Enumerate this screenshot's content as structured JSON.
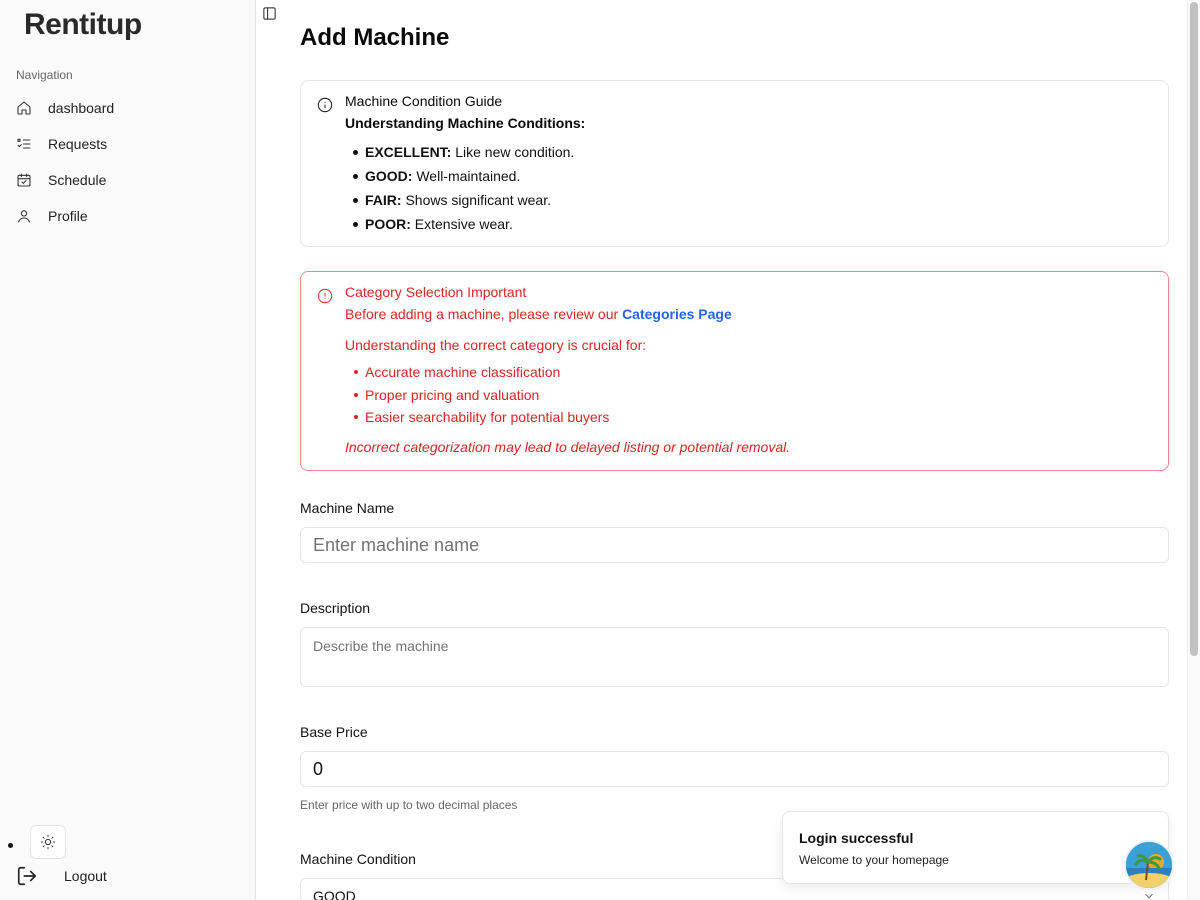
{
  "app": {
    "brand": "Rentitup"
  },
  "sidebar": {
    "caption": "Navigation",
    "items": [
      {
        "label": "dashboard",
        "icon": "home-icon"
      },
      {
        "label": "Requests",
        "icon": "list-icon"
      },
      {
        "label": "Schedule",
        "icon": "calendar-icon"
      },
      {
        "label": "Profile",
        "icon": "user-icon"
      }
    ],
    "logout_label": "Logout"
  },
  "page": {
    "title": "Add Machine"
  },
  "guide": {
    "title": "Machine Condition Guide",
    "subtitle": "Understanding Machine Conditions:",
    "items": [
      {
        "term": "EXCELLENT:",
        "desc": " Like new condition."
      },
      {
        "term": "GOOD:",
        "desc": " Well-maintained."
      },
      {
        "term": "FAIR:",
        "desc": " Shows significant wear."
      },
      {
        "term": "POOR:",
        "desc": " Extensive wear."
      }
    ]
  },
  "category_alert": {
    "title": "Category Selection Important",
    "line_prefix": "Before adding a machine, please review our ",
    "link_label": "Categories Page",
    "line2": "Understanding the correct category is crucial for:",
    "items": [
      "Accurate machine classification",
      "Proper pricing and valuation",
      "Easier searchability for potential buyers"
    ],
    "note": "Incorrect categorization may lead to delayed listing or potential removal."
  },
  "form": {
    "name_label": "Machine Name",
    "name_placeholder": "Enter machine name",
    "description_label": "Description",
    "description_placeholder": "Describe the machine",
    "price_label": "Base Price",
    "price_value": "0",
    "price_helper": "Enter price with up to two decimal places",
    "condition_label": "Machine Condition",
    "condition_value": "GOOD"
  },
  "toast": {
    "title": "Login successful",
    "body": "Welcome to your homepage"
  },
  "colors": {
    "alert": "#dc2626",
    "link": "#2563eb",
    "sidebar_bg": "#fafafa"
  }
}
